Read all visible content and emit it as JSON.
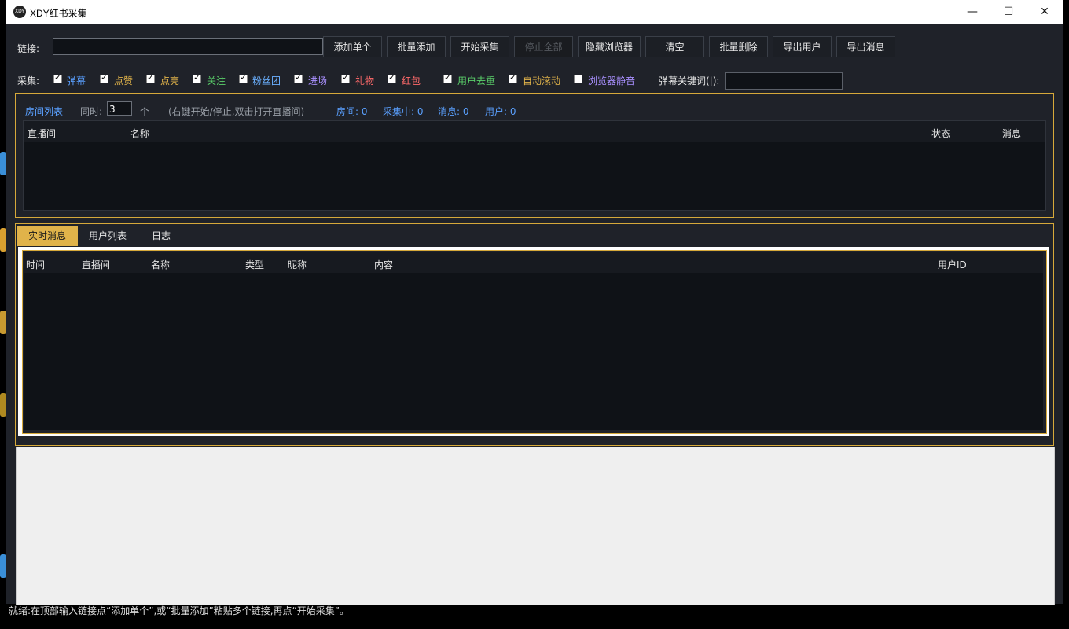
{
  "window": {
    "title": "XDY红书采集",
    "logo_text": "XDY",
    "minimize": "—",
    "maximize": "☐",
    "close": "✕"
  },
  "toolbar": {
    "link_label": "链接:",
    "link_value": "",
    "buttons": [
      "添加单个",
      "批量添加",
      "开始采集",
      "停止全部",
      "隐藏浏览器",
      "清空",
      "批量删除",
      "导出用户",
      "导出消息"
    ]
  },
  "collect": {
    "label": "采集:",
    "options": [
      {
        "label": "弹幕",
        "checked": true,
        "color": "#5aa0ff"
      },
      {
        "label": "点赞",
        "checked": true,
        "color": "#e0b34a"
      },
      {
        "label": "点亮",
        "checked": true,
        "color": "#e0b34a"
      },
      {
        "label": "关注",
        "checked": true,
        "color": "#5ad06a"
      },
      {
        "label": "粉丝团",
        "checked": true,
        "color": "#6ab0ff"
      },
      {
        "label": "进场",
        "checked": true,
        "color": "#a990ff"
      },
      {
        "label": "礼物",
        "checked": true,
        "color": "#ff6a6a"
      },
      {
        "label": "红包",
        "checked": true,
        "color": "#ff6a6a"
      },
      {
        "label": "用户去重",
        "checked": true,
        "color": "#5ad06a"
      },
      {
        "label": "自动滚动",
        "checked": true,
        "color": "#e0b34a"
      },
      {
        "label": "浏览器静音",
        "checked": false,
        "color": "#a990ff"
      }
    ],
    "keyword_label": "弹幕关键词(|):",
    "keyword_value": ""
  },
  "rooms": {
    "title": "房间列表",
    "concurrent_label": "同时:",
    "concurrent_value": "3",
    "unit": "个",
    "hint": "(右键开始/停止,双击打开直播间)",
    "stats": [
      "房间: 0",
      "采集中: 0",
      "消息: 0",
      "用户: 0"
    ],
    "columns": [
      "直播间",
      "名称",
      "状态",
      "消息"
    ]
  },
  "messages": {
    "tabs": [
      "实时消息",
      "用户列表",
      "日志"
    ],
    "columns": [
      "时间",
      "直播间",
      "名称",
      "类型",
      "昵称",
      "内容",
      "用户ID"
    ]
  },
  "status": "就绪:在顶部输入链接点“添加单个”,或“批量添加”粘贴多个链接,再点“开始采集”。",
  "colors": {
    "accent": "#d6a93a",
    "stat_blue": "#5aa0ff"
  }
}
